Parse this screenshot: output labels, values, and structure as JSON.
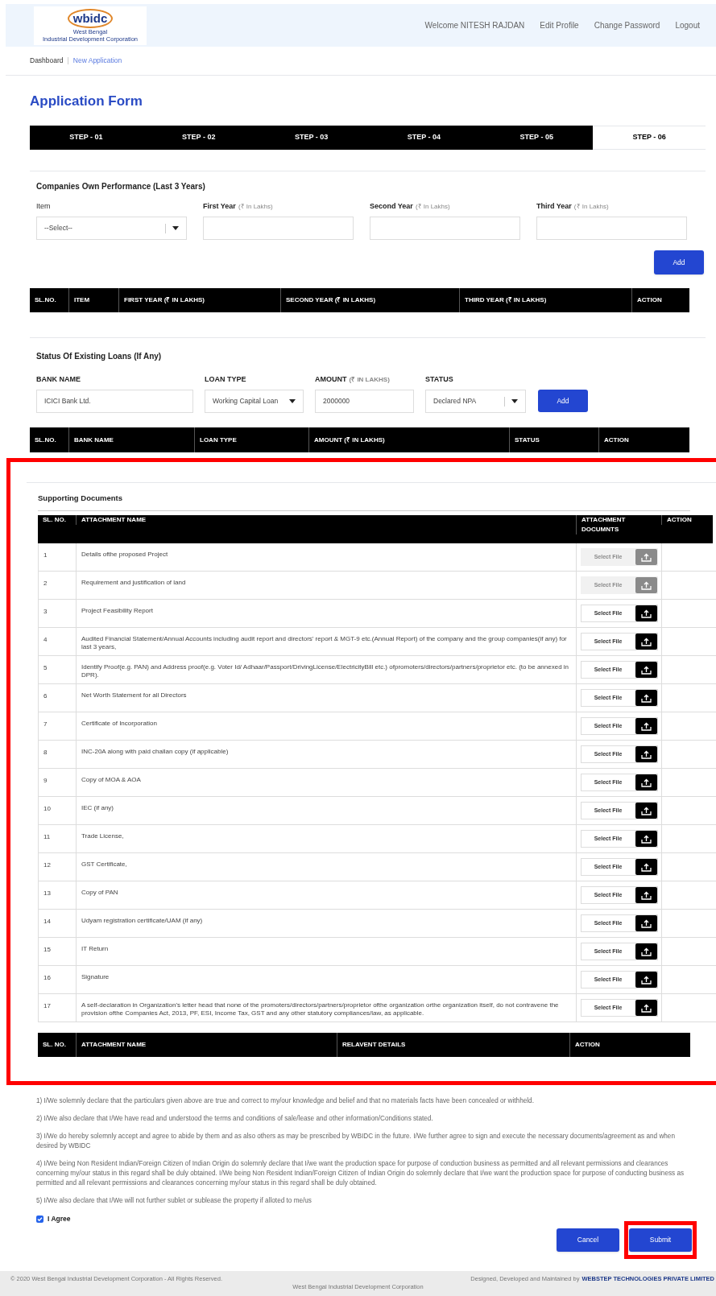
{
  "header": {
    "logo_text": "wbidc",
    "logo_subtitle": [
      "West Bengal",
      "Industrial Development Corporation"
    ],
    "welcome": "Welcome NITESH RAJDAN",
    "links": [
      "Edit Profile",
      "Change Password",
      "Logout"
    ]
  },
  "breadcrumb": {
    "separator": "|",
    "items": [
      {
        "label": "Dashboard",
        "current": false
      },
      {
        "label": "New Application",
        "current": true
      }
    ]
  },
  "page_title": "Application Form",
  "steps": [
    {
      "label": "STEP - 01",
      "selected": false
    },
    {
      "label": "STEP - 02",
      "selected": false
    },
    {
      "label": "STEP - 03",
      "selected": false
    },
    {
      "label": "STEP - 04",
      "selected": false
    },
    {
      "label": "STEP - 05",
      "selected": false
    },
    {
      "label": "STEP - 06",
      "selected": true
    }
  ],
  "performance": {
    "title": "Companies Own Performance (Last 3 Years)",
    "fields": [
      {
        "kind": "select",
        "label": "Item",
        "value": "--Select--"
      },
      {
        "kind": "text",
        "label": "First Year",
        "unit": "(₹ In Lakhs)"
      },
      {
        "kind": "text",
        "label": "Second Year",
        "unit": "(₹ In Lakhs)"
      },
      {
        "kind": "text",
        "label": "Third Year",
        "unit": "(₹ In Lakhs)"
      }
    ],
    "add_button": "Add",
    "columns": [
      "SL.NO.",
      "ITEM",
      "FIRST YEAR (₹ IN LAKHS)",
      "SECOND YEAR (₹ IN LAKHS)",
      "THIRD YEAR (₹ IN LAKHS)",
      "ACTION"
    ]
  },
  "loans": {
    "title": "Status Of Existing Loans (If Any)",
    "fields": [
      {
        "kind": "text",
        "label": "BANK NAME",
        "value": "ICICI Bank Ltd."
      },
      {
        "kind": "compact-select",
        "label": "LOAN TYPE",
        "value": "Working Capital Loan"
      },
      {
        "kind": "text",
        "label": "AMOUNT",
        "unit": "(₹ IN LAKHS)",
        "value": "2000000"
      },
      {
        "kind": "select",
        "label": "STATUS",
        "value": "Declared NPA"
      }
    ],
    "add_button": "Add",
    "columns": [
      "SL.NO.",
      "BANK NAME",
      "LOAN TYPE",
      "AMOUNT (₹ IN LAKHS)",
      "STATUS",
      "ACTION"
    ]
  },
  "documents": {
    "highlighted": true,
    "title": "Supporting Documents",
    "columns": [
      "SL. NO.",
      "ATTACHMENT NAME",
      "ATTACHMENT DOCUMNTS",
      "ACTION"
    ],
    "rows": [
      {
        "sl": "1",
        "name": "Details ofthe proposed Project",
        "file_button": "Select File",
        "disabled": true
      },
      {
        "sl": "2",
        "name": "Requirement and justification of land",
        "file_button": "Select File",
        "disabled": true
      },
      {
        "sl": "3",
        "name": "Project Feasibility Report",
        "file_button": "Select File",
        "disabled": false
      },
      {
        "sl": "4",
        "name": "Audited Financial Statement/Annual Accounts including audit report and directors' report & MGT-9 etc.(Annual Report) of the company and the group companies(if any) for last 3 years,",
        "file_button": "Select File",
        "disabled": false
      },
      {
        "sl": "5",
        "name": "Identify Proof(e.g. PAN) and Address proof(e.g. Voter Id/ Adhaar/Passport/DrivingLicense/ElectricityBill etc.) ofpromoters/directors/partners/proprietor etc. (to be annexed in DPR).",
        "file_button": "Select File",
        "disabled": false
      },
      {
        "sl": "6",
        "name": "Net Worth Statement for all Directors",
        "file_button": "Select File",
        "disabled": false
      },
      {
        "sl": "7",
        "name": "Certificate of Incorporation",
        "file_button": "Select File",
        "disabled": false
      },
      {
        "sl": "8",
        "name": "INC-20A along with paid challan copy (if applicable)",
        "file_button": "Select File",
        "disabled": false
      },
      {
        "sl": "9",
        "name": "Copy of MOA & AOA",
        "file_button": "Select File",
        "disabled": false
      },
      {
        "sl": "10",
        "name": "IEC (if any)",
        "file_button": "Select File",
        "disabled": false
      },
      {
        "sl": "11",
        "name": "Trade License,",
        "file_button": "Select File",
        "disabled": false
      },
      {
        "sl": "12",
        "name": "GST Certificate,",
        "file_button": "Select File",
        "disabled": false
      },
      {
        "sl": "13",
        "name": "Copy of PAN",
        "file_button": "Select File",
        "disabled": false
      },
      {
        "sl": "14",
        "name": "Udyam registration certificate/UAM (if any)",
        "file_button": "Select File",
        "disabled": false
      },
      {
        "sl": "15",
        "name": "IT Return",
        "file_button": "Select File",
        "disabled": false
      },
      {
        "sl": "16",
        "name": "Signature",
        "file_button": "Select File",
        "disabled": false
      },
      {
        "sl": "17",
        "name": "A self-declaration in Organization's letter head that none of the promoters/directors/partners/proprietor ofthe organization orthe organization itself, do not contravene the provision ofthe Companies Act, 2013, PF, ESI, Income Tax, GST and any other statutory compliances/law, as applicable.",
        "file_button": "Select File",
        "disabled": false
      }
    ],
    "uploaded_columns": [
      "SL. NO.",
      "ATTACHMENT NAME",
      "RELAVENT DETAILS",
      "ACTION"
    ]
  },
  "declarations": [
    "1) I/We solemnly declare that the particulars given above are true and correct to my/our knowledge and belief and that no materials facts have been concealed or withheld.",
    "2) I/We also declare that I/We have read and understood the terms and conditions of sale/lease and other information/Conditions stated.",
    "3) I/We do hereby solemnly accept and agree to abide by them and as also others as may be prescribed by WBIDC in the future. I/We further agree to sign and execute the necessary documents/agreement as and when desired by WBIDC",
    "4) I/We being Non Resident Indian/Foreign Citizen of Indian Origin do solemnly declare that I/we want the production space for purpose of conduction business as permitted and all relevant permissions and clearances concerning my/our status in this regard shall be duly obtained. I/We being Non Resident Indian/Foreign Citizen of Indian Origin do solemnly declare that I/we want the production space for purpose of conducting business as permitted and all relevant permissions and clearances concerning my/our status in this regard shall be duly obtained.",
    "5) I/We also declare that I/We will not further sublet or sublease the property if alloted to me/us"
  ],
  "agree": {
    "label": "I Agree",
    "checked": true
  },
  "buttons": [
    {
      "label": "Cancel",
      "highlighted": false
    },
    {
      "label": "Submit",
      "highlighted": true
    }
  ],
  "footer": {
    "copyright": "© 2020 West Bengal Industrial Development Corporation - All Rights Reserved.",
    "center": "West Bengal Industrial Development Corporation",
    "credit": "Designed, Developed and Maintained by",
    "credit_link": "WEBSTEP TECHNOLOGIES PRIVATE LIMITED"
  }
}
